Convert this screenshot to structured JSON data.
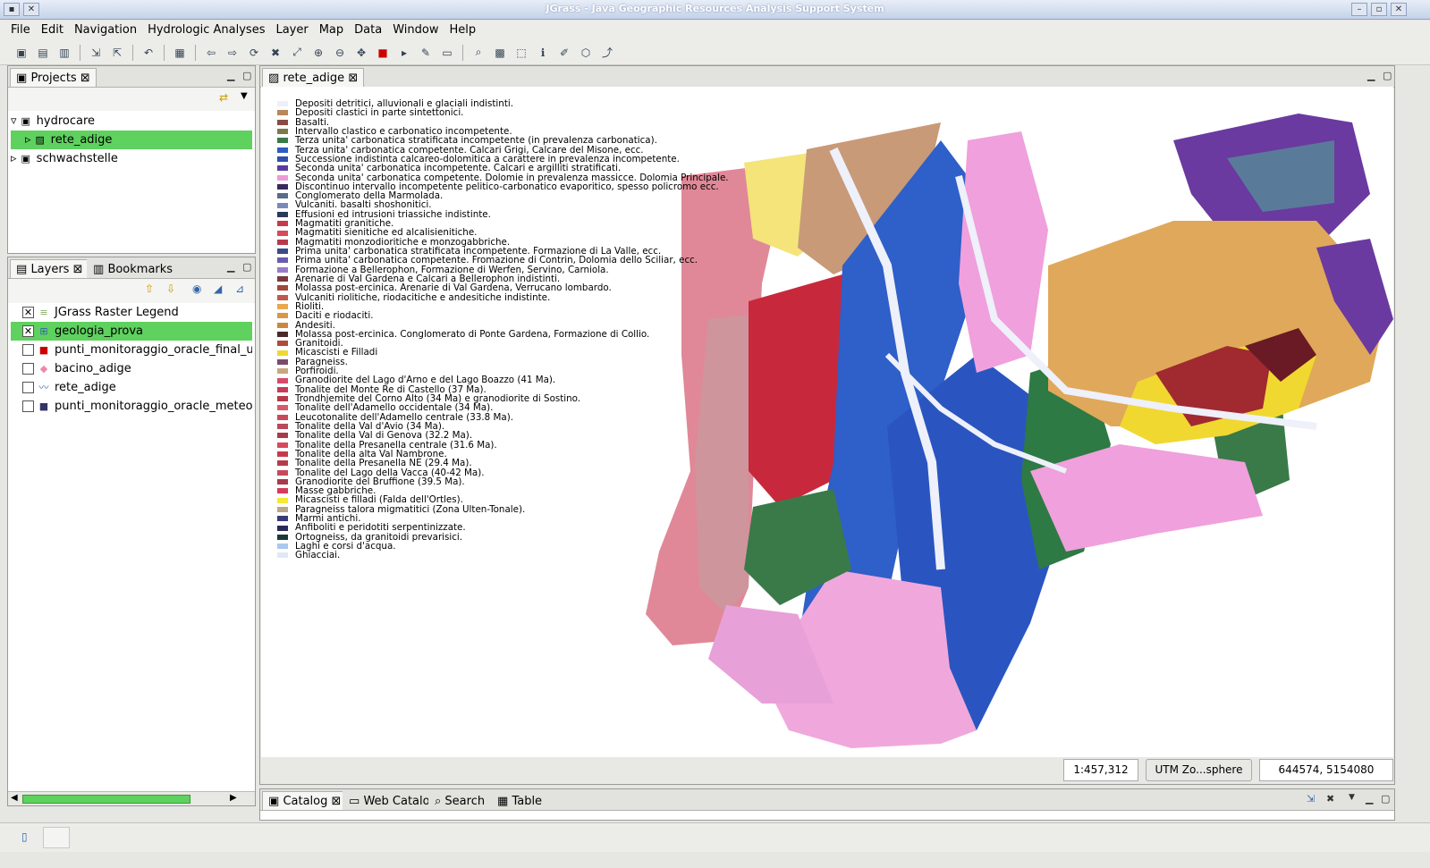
{
  "window": {
    "title": "JGrass - Java Geographic Resources Analysis Support System"
  },
  "menu": [
    "File",
    "Edit",
    "Navigation",
    "Hydrologic Analyses",
    "Layer",
    "Map",
    "Data",
    "Window",
    "Help"
  ],
  "projects_panel": {
    "tab": "Projects",
    "items": [
      {
        "label": "hydrocare",
        "level": 0,
        "expanded": true
      },
      {
        "label": "rete_adige",
        "level": 1,
        "selected": true
      },
      {
        "label": "schwachstelle",
        "level": 0
      }
    ]
  },
  "layers_panel": {
    "tabs": [
      "Layers",
      "Bookmarks"
    ],
    "items": [
      {
        "label": "JGrass Raster Legend",
        "checked": true,
        "icon": "legend-icon"
      },
      {
        "label": "geologia_prova",
        "checked": true,
        "selected": true,
        "icon": "raster-grid-icon"
      },
      {
        "label": "punti_monitoraggio_oracle_final_utm_c",
        "checked": false,
        "icon": "point-icon"
      },
      {
        "label": "bacino_adige",
        "checked": false,
        "icon": "polygon-icon"
      },
      {
        "label": "rete_adige",
        "checked": false,
        "icon": "line-icon"
      },
      {
        "label": "punti_monitoraggio_oracle_meteo",
        "checked": false,
        "icon": "point-icon"
      }
    ]
  },
  "map_editor": {
    "tab": "rete_adige"
  },
  "legend": [
    {
      "label": "Depositi detritici, alluvionali e glaciali indistinti.",
      "color": "#f0eef8"
    },
    {
      "label": "Depositi clastici in parte sintettonici.",
      "color": "#b8875a"
    },
    {
      "label": "Basalti.",
      "color": "#8b4a42"
    },
    {
      "label": "Intervallo clastico e carbonatico incompetente.",
      "color": "#7d7a4a"
    },
    {
      "label": "Terza unita' carbonatica stratificata incompetente (in prevalenza carbonatica).",
      "color": "#3a7a4a"
    },
    {
      "label": "Terza unita' carbonatica competente. Calcari Grigi, Calcare del Misone, ecc.",
      "color": "#2d5cc4"
    },
    {
      "label": "Successione indistinta calcareo-dolomitica a carattere in prevalenza incompetente.",
      "color": "#2f4faa"
    },
    {
      "label": "Seconda unita' carbonatica incompetente. Calcari e argilliti stratificati.",
      "color": "#5a3ca0"
    },
    {
      "label": "Seconda unita' carbonatica competente. Dolomie in prevalenza massicce. Dolomia Principale.",
      "color": "#ee9ad8"
    },
    {
      "label": "Discontinuo intervallo incompetente pelitico-carbonatico evaporitico, spesso policromo ecc.",
      "color": "#3a2a5a"
    },
    {
      "label": "Conglomerato della Marmolada.",
      "color": "#5a6a8a"
    },
    {
      "label": "Vulcaniti. basalti shoshonitici.",
      "color": "#7a8ab8"
    },
    {
      "label": "Effusioni ed intrusioni triassiche indistinte.",
      "color": "#2a3a5a"
    },
    {
      "label": "Magmatiti granitiche.",
      "color": "#c83a4a"
    },
    {
      "label": "Magmatiti sienitiche ed alcalisienitiche.",
      "color": "#d84a5a"
    },
    {
      "label": "Magmatiti monzodioritiche e monzogabbriche.",
      "color": "#b83a4a"
    },
    {
      "label": "Prima unita' carbonatica stratificata incompetente. Formazione di La Valle, ecc.",
      "color": "#3a4a8a"
    },
    {
      "label": "Prima unita' carbonatica competente. Fromazione di Contrin, Dolomia dello Sciliar, ecc.",
      "color": "#6a5ab0"
    },
    {
      "label": "Formazione a Bellerophon, Formazione di Werfen, Servino, Carniola.",
      "color": "#9a7ac8"
    },
    {
      "label": "Arenarie di Val Gardena e Calcari a Bellerophon indistinti.",
      "color": "#7a3a3a"
    },
    {
      "label": "Molassa post-ercinica. Arenarie di Val Gardena, Verrucano lombardo.",
      "color": "#a04a3a"
    },
    {
      "label": "Vulcaniti riolitiche, riodacitiche e andesitiche indistinte.",
      "color": "#c05a4a"
    },
    {
      "label": "Rioliti.",
      "color": "#e8a850"
    },
    {
      "label": "Daciti e riodaciti.",
      "color": "#d89848"
    },
    {
      "label": "Andesiti.",
      "color": "#c88840"
    },
    {
      "label": "Molassa post-ercinica. Conglomerato di Ponte Gardena, Formazione di Collio.",
      "color": "#4a2a2a"
    },
    {
      "label": "Granitoidi.",
      "color": "#b04a3a"
    },
    {
      "label": "Micascisti e Filladi",
      "color": "#f0d830"
    },
    {
      "label": "Paragneiss.",
      "color": "#7a4a6a"
    },
    {
      "label": "Porfiroidi.",
      "color": "#c8a880"
    },
    {
      "label": "Granodiorite del Lago d'Arno e del Lago Boazzo (41 Ma).",
      "color": "#d84a6a"
    },
    {
      "label": "Tonalite del Monte Re di Castello (37 Ma).",
      "color": "#c83a5a"
    },
    {
      "label": "Trondhjemite del Corno Alto (34 Ma) e granodiorite di Sostino.",
      "color": "#b83a4a"
    },
    {
      "label": "Tonalite dell'Adamello occidentale (34 Ma).",
      "color": "#d85a6a"
    },
    {
      "label": "Leucotonalite dell'Adamello centrale (33.8 Ma).",
      "color": "#c84a5a"
    },
    {
      "label": "Tonalite della Val d'Avio (34 Ma).",
      "color": "#b84a5a"
    },
    {
      "label": "Tonalite della Val di Genova (32.2 Ma).",
      "color": "#a83a4a"
    },
    {
      "label": "Tonalite della Presanella centrale (31.6 Ma).",
      "color": "#d84a5a"
    },
    {
      "label": "Tonalite della alta Val Nambrone.",
      "color": "#c83a4a"
    },
    {
      "label": "Tonalite della Presanella NE (29.4 Ma).",
      "color": "#b83a4a"
    },
    {
      "label": "Tonalite del Lago della Vacca (40-42 Ma).",
      "color": "#c84a5a"
    },
    {
      "label": "Granodiorite del Bruffione (39.5 Ma).",
      "color": "#a83a4a"
    },
    {
      "label": "Masse gabbriche.",
      "color": "#d83a5a"
    },
    {
      "label": "Micascisti e filladi (Falda dell'Ortles).",
      "color": "#f8e830"
    },
    {
      "label": "Paragneiss talora migmatitici (Zona Ulten-Tonale).",
      "color": "#b8a888"
    },
    {
      "label": "Marmi antichi.",
      "color": "#3a3a7a"
    },
    {
      "label": "Anfiboliti e peridotiti serpentinizzate.",
      "color": "#2a2a5a"
    },
    {
      "label": "Ortogneiss, da granitoidi prevarisici.",
      "color": "#1a3a3a"
    },
    {
      "label": "Laghi e corsi d'acqua.",
      "color": "#a8c8f0"
    },
    {
      "label": "Ghiacciai.",
      "color": "#e0e8f8"
    }
  ],
  "statusbar": {
    "scale": "1:457,312",
    "crs": "UTM Zo...sphere",
    "coords": "644574, 5154080"
  },
  "bottom_panel": {
    "tabs": [
      "Catalog",
      "Web Catalog",
      "Search",
      "Table"
    ]
  }
}
